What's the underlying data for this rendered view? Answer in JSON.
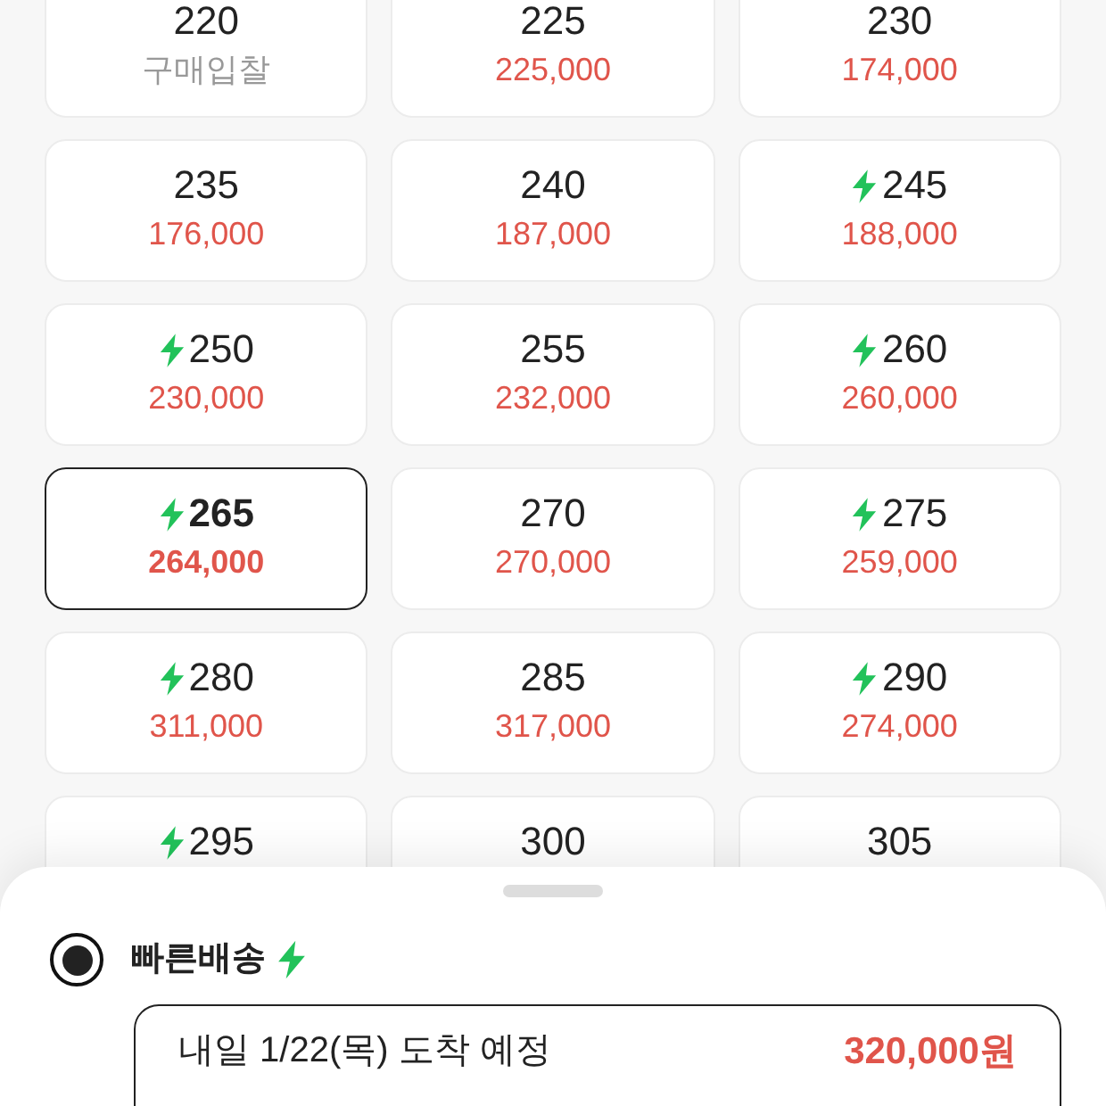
{
  "sizes": [
    {
      "size": "220",
      "price": "구매입찰",
      "kind": "bid",
      "fast": false,
      "selected": false
    },
    {
      "size": "225",
      "price": "225,000",
      "kind": "price",
      "fast": false,
      "selected": false
    },
    {
      "size": "230",
      "price": "174,000",
      "kind": "price",
      "fast": false,
      "selected": false
    },
    {
      "size": "235",
      "price": "176,000",
      "kind": "price",
      "fast": false,
      "selected": false
    },
    {
      "size": "240",
      "price": "187,000",
      "kind": "price",
      "fast": false,
      "selected": false
    },
    {
      "size": "245",
      "price": "188,000",
      "kind": "price",
      "fast": true,
      "selected": false
    },
    {
      "size": "250",
      "price": "230,000",
      "kind": "price",
      "fast": true,
      "selected": false
    },
    {
      "size": "255",
      "price": "232,000",
      "kind": "price",
      "fast": false,
      "selected": false
    },
    {
      "size": "260",
      "price": "260,000",
      "kind": "price",
      "fast": true,
      "selected": false
    },
    {
      "size": "265",
      "price": "264,000",
      "kind": "price",
      "fast": true,
      "selected": true
    },
    {
      "size": "270",
      "price": "270,000",
      "kind": "price",
      "fast": false,
      "selected": false
    },
    {
      "size": "275",
      "price": "259,000",
      "kind": "price",
      "fast": true,
      "selected": false
    },
    {
      "size": "280",
      "price": "311,000",
      "kind": "price",
      "fast": true,
      "selected": false
    },
    {
      "size": "285",
      "price": "317,000",
      "kind": "price",
      "fast": false,
      "selected": false
    },
    {
      "size": "290",
      "price": "274,000",
      "kind": "price",
      "fast": true,
      "selected": false
    },
    {
      "size": "295",
      "fast": true,
      "selected": false
    },
    {
      "size": "300",
      "fast": false,
      "selected": false
    },
    {
      "size": "305",
      "fast": false,
      "selected": false
    }
  ],
  "sheet": {
    "option": {
      "label": "빠른배송",
      "selected": true,
      "fast": true
    },
    "delivery": {
      "label": "내일 1/22(목) 도착 예정",
      "price": "320,000원"
    }
  }
}
